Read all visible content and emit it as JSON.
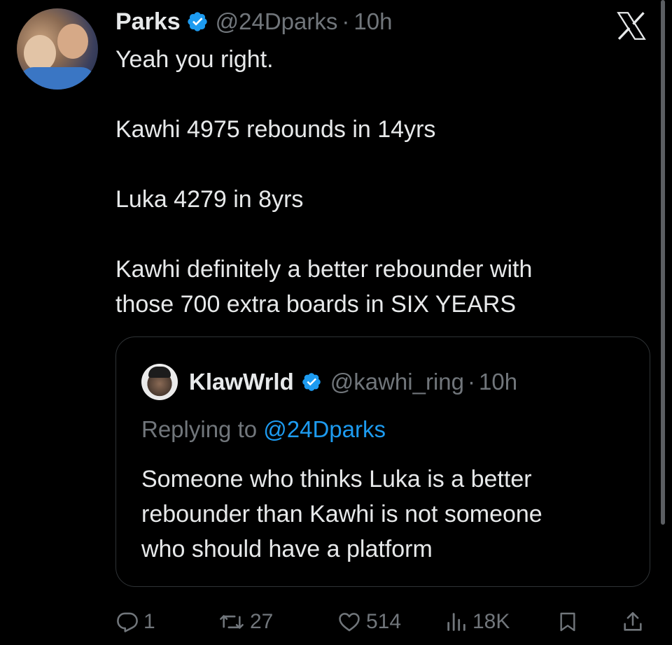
{
  "tweet": {
    "author": {
      "display_name": "Parks",
      "handle": "@24Dparks",
      "separator": "·",
      "time": "10h",
      "verified": true
    },
    "body_lines": [
      "Yeah you right.",
      "",
      "Kawhi 4975  rebounds in 14yrs",
      "",
      "Luka 4279 in 8yrs",
      "",
      "Kawhi definitely a better rebounder with",
      "those 700 extra boards in SIX YEARS"
    ]
  },
  "quoted_tweet": {
    "author": {
      "display_name": "KlawWrld",
      "handle": "@kawhi_ring",
      "separator": "·",
      "time": "10h",
      "verified": true
    },
    "replying_prefix": "Replying to ",
    "replying_to": "@24Dparks",
    "body_lines": [
      "Someone who thinks Luka is a better",
      "rebounder than Kawhi is not someone",
      "who should have a platform"
    ]
  },
  "actions": {
    "replies": "1",
    "reposts": "27",
    "likes": "514",
    "views": "18K"
  },
  "icons": {
    "platform_logo": "x-logo-icon",
    "verified": "verified-badge-icon",
    "reply": "reply-icon",
    "repost": "repost-icon",
    "like": "heart-icon",
    "views": "views-chart-icon",
    "bookmark": "bookmark-icon",
    "share": "share-icon"
  },
  "colors": {
    "background": "#000000",
    "text_primary": "#e7e9ea",
    "text_secondary": "#71767b",
    "accent": "#1d9bf0",
    "border": "#2f3336"
  }
}
